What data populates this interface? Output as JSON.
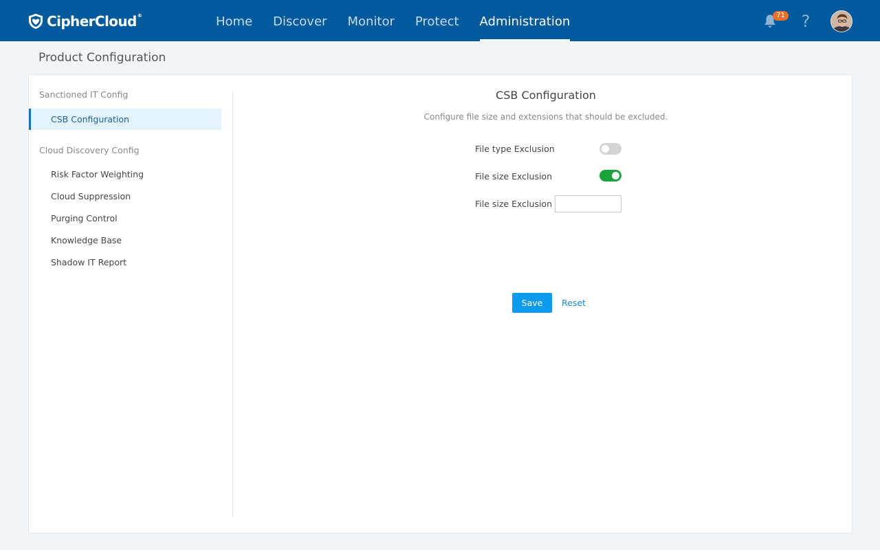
{
  "brand": {
    "name": "CipherCloud",
    "registered_mark": "®",
    "header_bg_color": "#005a9c"
  },
  "nav": {
    "items": [
      {
        "label": "Home",
        "active": false
      },
      {
        "label": "Discover",
        "active": false
      },
      {
        "label": "Monitor",
        "active": false
      },
      {
        "label": "Protect",
        "active": false
      },
      {
        "label": "Administration",
        "active": true
      }
    ]
  },
  "header_actions": {
    "notifications_icon": "bell-icon",
    "notification_count": "71",
    "badge_color": "#e8702a",
    "help_icon": "question-mark-icon",
    "help_label": "?",
    "avatar_icon": "user-avatar"
  },
  "page": {
    "title": "Product Configuration"
  },
  "sidebar": {
    "groups": [
      {
        "label": "Sanctioned IT Config",
        "items": [
          {
            "label": "CSB Configuration",
            "active": true
          }
        ]
      },
      {
        "label": "Cloud Discovery Config",
        "items": [
          {
            "label": "Risk Factor Weighting",
            "active": false
          },
          {
            "label": "Cloud Suppression",
            "active": false
          },
          {
            "label": "Purging Control",
            "active": false
          },
          {
            "label": "Knowledge Base",
            "active": false
          },
          {
            "label": "Shadow IT Report",
            "active": false
          }
        ]
      }
    ]
  },
  "main": {
    "title": "CSB Configuration",
    "subtitle": "Configure file size and extensions that should be excluded.",
    "fields": [
      {
        "label": "File type Exclusion",
        "type": "toggle",
        "enabled": false
      },
      {
        "label": "File size Exclusion",
        "type": "toggle",
        "enabled": true,
        "on_color": "#1aa33a"
      },
      {
        "label": "File size Exclusion",
        "type": "text",
        "value": "",
        "placeholder": ""
      }
    ],
    "save_label": "Save",
    "reset_label": "Reset",
    "save_color": "#0a9af0"
  }
}
